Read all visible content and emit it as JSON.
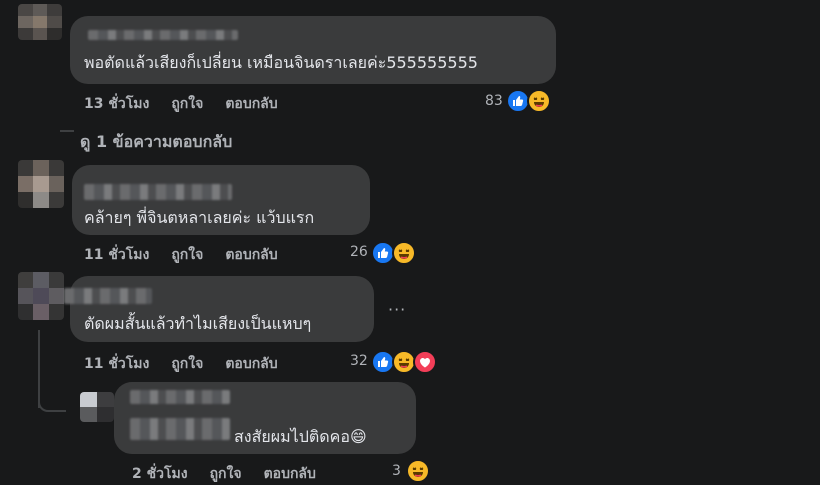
{
  "comments": [
    {
      "text": "พอตัดแล้วเสียงก็เปลี่ยน เหมือนจินดราเลยค่ะ555555555",
      "time": "13 ชั่วโมง",
      "like_label": "ถูกใจ",
      "reply_label": "ตอบกลับ",
      "reaction_count": "83",
      "reactions": [
        "like-icon",
        "haha-icon"
      ]
    },
    {
      "text": "คล้ายๆ พี่จินตหลาเลยค่ะ แว้บแรก",
      "time": "11 ชั่วโมง",
      "like_label": "ถูกใจ",
      "reply_label": "ตอบกลับ",
      "reaction_count": "26",
      "reactions": [
        "like-icon",
        "haha-icon"
      ]
    },
    {
      "text": "ตัดผมสั้นแล้วทำไมเสียงเป็นแหบๆ",
      "time": "11 ชั่วโมง",
      "like_label": "ถูกใจ",
      "reply_label": "ตอบกลับ",
      "reaction_count": "32",
      "reactions": [
        "like-icon",
        "haha-icon",
        "love-icon"
      ],
      "more_label": "···"
    },
    {
      "text": "สงสัยผมไปติดคอ😄",
      "time": "2 ชั่วโมง",
      "like_label": "ถูกใจ",
      "reply_label": "ตอบกลับ",
      "reaction_count": "3",
      "reactions": [
        "haha-icon"
      ]
    }
  ],
  "view_replies": "ดู 1 ข้อความตอบกลับ",
  "colors": {
    "background": "#18191a",
    "bubble": "#3a3b3c",
    "text": "#e4e6eb",
    "meta": "#b0b3b8",
    "like": "#1877f2",
    "haha": "#f7b928",
    "love": "#f33e58"
  }
}
